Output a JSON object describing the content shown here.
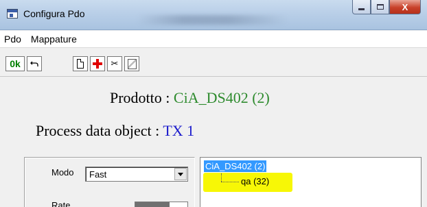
{
  "window": {
    "title": "Configura Pdo",
    "controls": {
      "minimize_icon": "minimize-icon",
      "maximize_icon": "maximize-icon",
      "close_label": "X"
    }
  },
  "menu": {
    "items": [
      "Pdo",
      "Mappature"
    ]
  },
  "toolbar": {
    "ok_label": "0k",
    "undo_icon": "undo-icon",
    "new_icon": "new-document-icon",
    "add_icon": "add-plus-icon",
    "cut_icon": "scissors-icon",
    "edit_icon": "edit-icon",
    "cut_glyph": "✂"
  },
  "header": {
    "product_label": "Prodotto : ",
    "product_value": "CiA_DS402 (2)",
    "pdo_label": "Process data object : ",
    "pdo_value": "TX 1"
  },
  "form": {
    "modo_label": "Modo",
    "modo_value": "Fast",
    "rate_label": "Rate"
  },
  "tree": {
    "root": "CiA_DS402 (2)",
    "child": "qa (32)"
  },
  "colors": {
    "product_value": "#2e8b2e",
    "pdo_value": "#1a1acc",
    "selection": "#3399ff",
    "highlight": "#f7f706",
    "ok": "#008000",
    "add": "#e00000"
  }
}
